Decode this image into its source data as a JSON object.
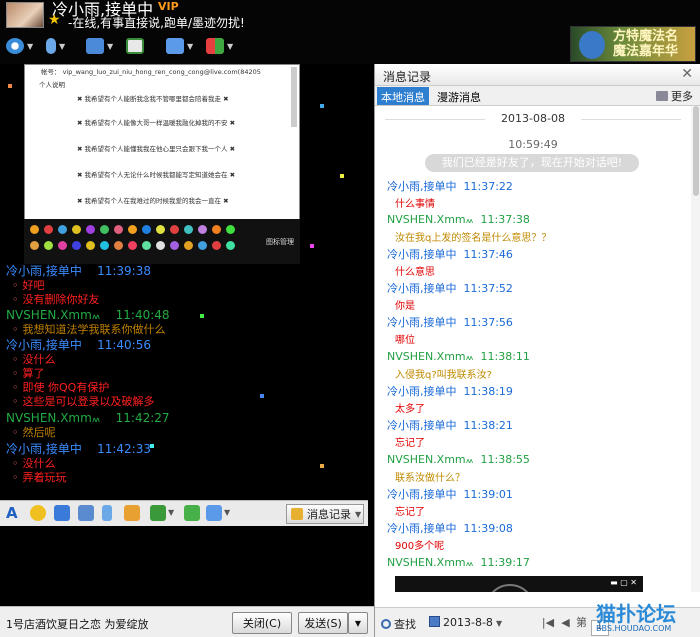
{
  "header": {
    "username": "冷小雨,接单中",
    "vip": "VIP",
    "signature": "-在线,有事直接说,跑单/墨迹勿扰!",
    "banner_text": [
      "方特魔法名",
      "魔法嘉年华"
    ]
  },
  "toolbar_icons": [
    "camera-icon",
    "mic-icon",
    "folder-icon",
    "add-chat-icon",
    "screen-share-icon",
    "apps-icon"
  ],
  "screenshot_lines": [
    "帐号：   vip_wang_luo_zui_niu_hong_ren_cong_cong@live.com(84205",
    "个人说明",
    "✖  我希望有个人能断我念我不管哪里都会陪着我走  ✖",
    "✖  我希望有个人能像大哥一样温暖我融化掉我的不安  ✖",
    "✖  我希望有个人能懂我我在他心里只会跟下我一个人  ✖",
    "✖  我希望有个人无论什么时候我都能写定知道她会在  ✖",
    "✖  我希望有个人在我难过的时候我爱的我会一直在  ✖"
  ],
  "emoji_manager": "图标管理",
  "chat": [
    {
      "sender": "冷小雨,接单中",
      "time": "11:39:38",
      "side": "a",
      "lines": [
        "好吧",
        "没有删除你好友"
      ]
    },
    {
      "sender": "NVSHEN.Xmm៳",
      "time": "11:40:48",
      "side": "b",
      "lines": [
        "我想知道法学我联系你做什么"
      ]
    },
    {
      "sender": "冷小雨,接单中",
      "time": "11:40:56",
      "side": "a",
      "lines": [
        "没什么",
        "算了",
        "即使 你QQ有保护",
        "这些是可以登录以及破解多"
      ]
    },
    {
      "sender": "NVSHEN.Xmm៳",
      "time": "11:42:27",
      "side": "b",
      "lines": [
        "然后呢"
      ]
    },
    {
      "sender": "冷小雨,接单中",
      "time": "11:42:33",
      "side": "a",
      "lines": [
        "没什么",
        "弄着玩玩"
      ]
    }
  ],
  "compose": {
    "history_toggle": "消息记录",
    "status_text": "1号店酒饮夏日之恋 为爱绽放",
    "close_label": "关闭(C)",
    "send_label": "发送(S)"
  },
  "history": {
    "title": "消息记录",
    "tabs": [
      "本地消息",
      "漫游消息"
    ],
    "more": "更多",
    "date": "2013-08-08",
    "sys_time": "10:59:49",
    "sys_msg": "我们已经是好友了，现在开始对话吧!",
    "entries": [
      {
        "sender": "冷小雨,接单中",
        "time": "11:37:22",
        "side": "a",
        "text": "什么事情"
      },
      {
        "sender": "NVSHEN.Xmm៳",
        "time": "11:37:38",
        "side": "b",
        "text": "汝在我q上发的签名是什么意思？？"
      },
      {
        "sender": "冷小雨,接单中",
        "time": "11:37:46",
        "side": "a",
        "text": "什么意思"
      },
      {
        "sender": "冷小雨,接单中",
        "time": "11:37:52",
        "side": "a",
        "text": "你是"
      },
      {
        "sender": "冷小雨,接单中",
        "time": "11:37:56",
        "side": "a",
        "text": "哪位"
      },
      {
        "sender": "NVSHEN.Xmm៳",
        "time": "11:38:11",
        "side": "b",
        "text": "入侵我q?叫我联系汝?"
      },
      {
        "sender": "冷小雨,接单中",
        "time": "11:38:19",
        "side": "a",
        "text": "太多了"
      },
      {
        "sender": "冷小雨,接单中",
        "time": "11:38:21",
        "side": "a",
        "text": "忘记了"
      },
      {
        "sender": "NVSHEN.Xmm៳",
        "time": "11:38:55",
        "side": "b",
        "text": "联系汝做什么？"
      },
      {
        "sender": "冷小雨,接单中",
        "time": "11:39:01",
        "side": "a",
        "text": "忘记了"
      },
      {
        "sender": "冷小雨,接单中",
        "time": "11:39:08",
        "side": "a",
        "text": "900多个呢"
      },
      {
        "sender": "NVSHEN.Xmm៳",
        "time": "11:39:17",
        "side": "b",
        "text": ""
      }
    ],
    "find": "查找",
    "date_filter": "2013-8-8",
    "page_label": "第",
    "page_value": "1"
  },
  "watermark": {
    "main": "猫扑论坛",
    "small": "BBS.HOUDAO.COM"
  },
  "colors": {
    "accent": "#2f7fd0",
    "name_a": "#3a8cff",
    "name_b": "#22aa44",
    "msg_red": "#ff2020",
    "msg_gold": "#c08000"
  }
}
